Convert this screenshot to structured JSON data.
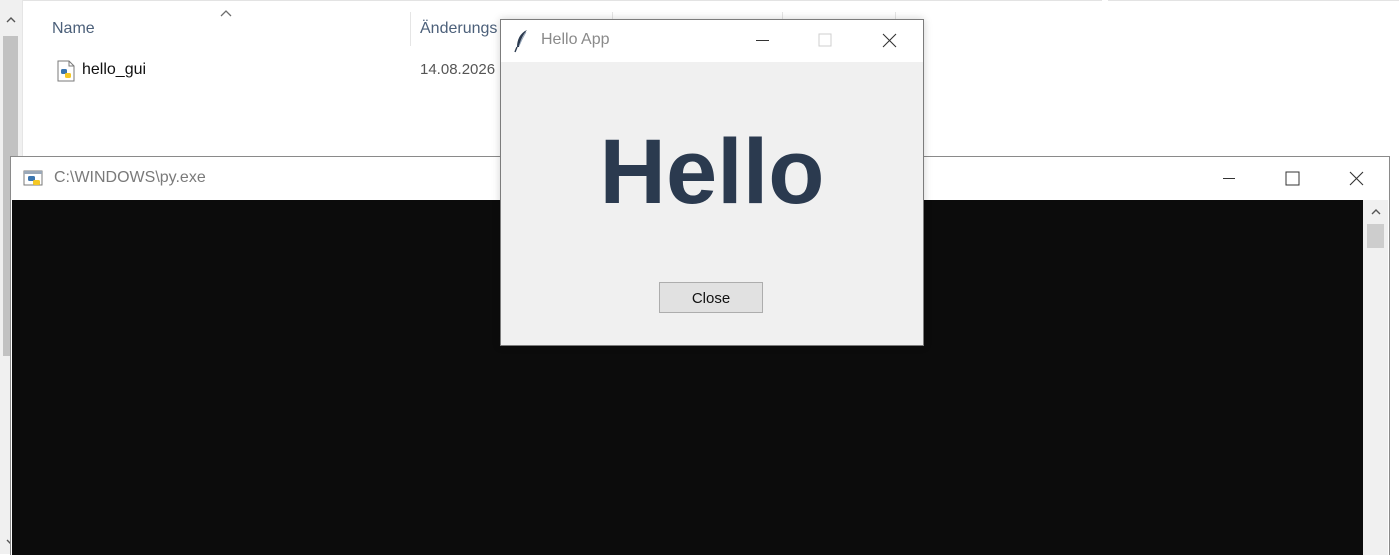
{
  "explorer": {
    "columns": {
      "name": "Name",
      "modified": "Änderungs"
    },
    "files": [
      {
        "name": "hello_gui",
        "modified": "14.08.2026"
      }
    ],
    "scroll_up_icon": "chevron-up-icon",
    "scroll_down_icon": "chevron-down-icon"
  },
  "console": {
    "title": "C:\\WINDOWS\\py.exe",
    "icon": "python-icon",
    "background": "#0c0c0c"
  },
  "hello_app": {
    "title": "Hello App",
    "icon": "feather-icon",
    "heading": "Hello",
    "heading_color": "#2b3a4f",
    "close_label": "Close"
  }
}
